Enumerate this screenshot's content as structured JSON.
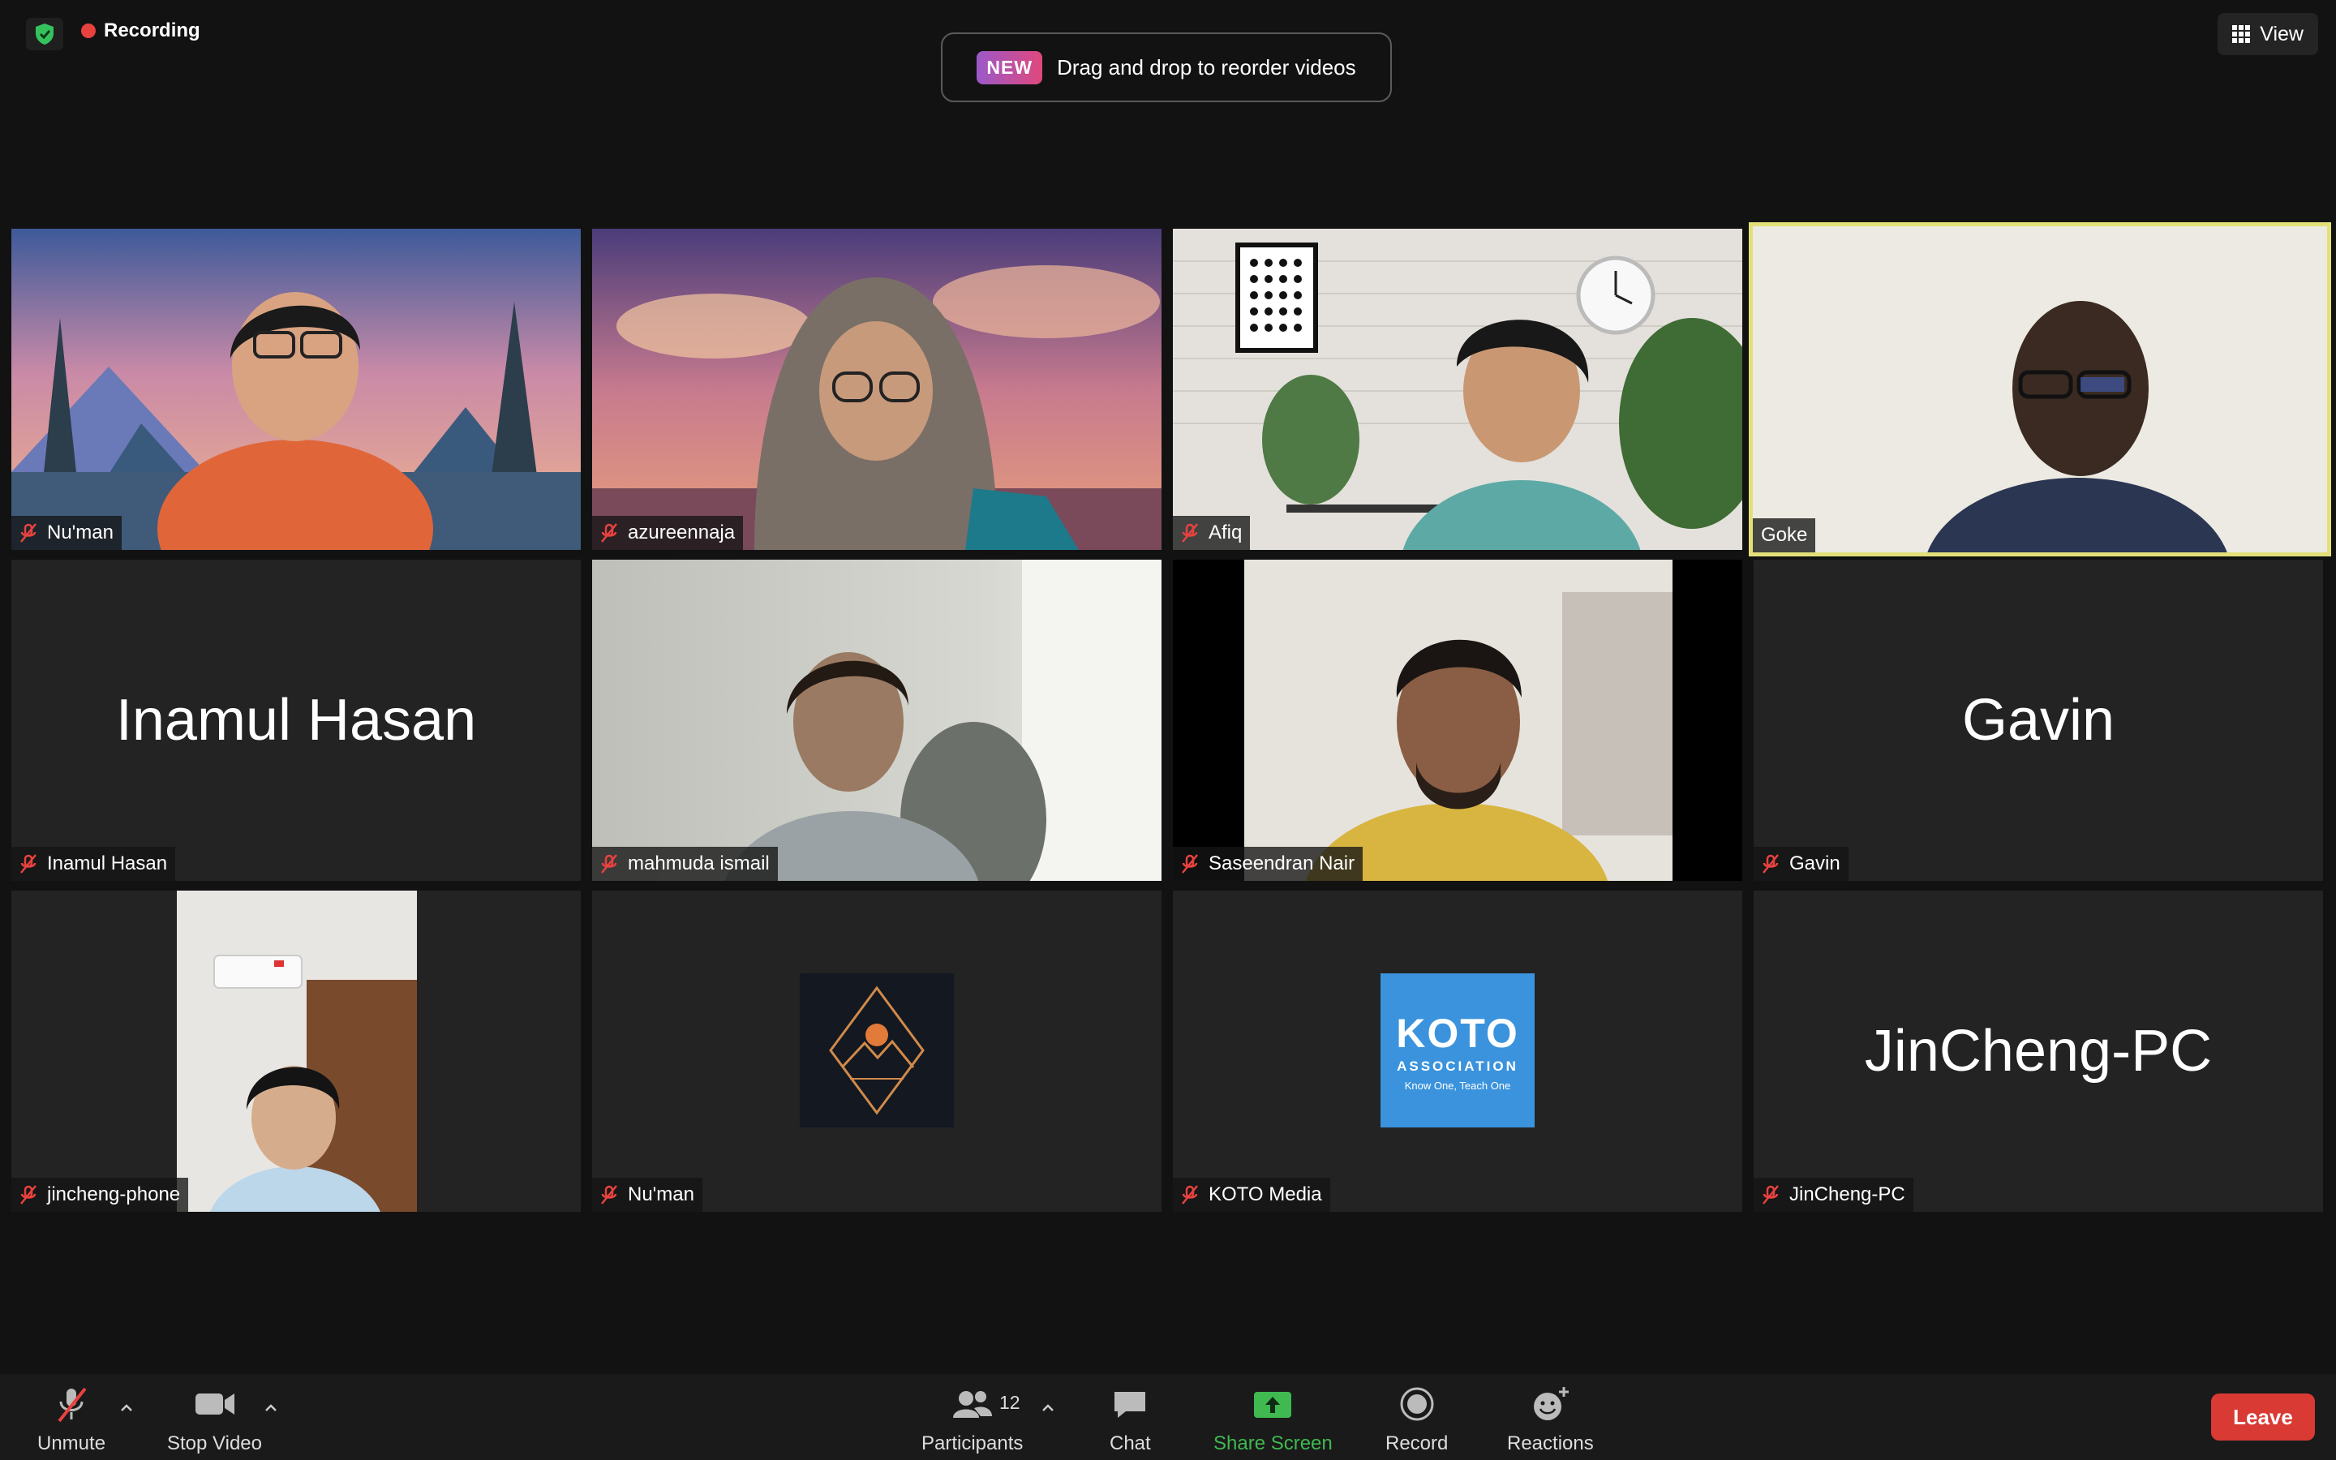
{
  "meeting": {
    "recording_label": "Recording",
    "banner_badge": "NEW",
    "banner_text": "Drag and drop to reorder videos",
    "view_label": "View"
  },
  "participants": [
    {
      "name": "Nu'man",
      "video": "photo",
      "muted": true
    },
    {
      "name": "azureennaja",
      "video": "photo",
      "muted": true
    },
    {
      "name": "Afiq",
      "video": "photo",
      "muted": true
    },
    {
      "name": "Goke",
      "video": "photo",
      "muted": false,
      "active_speaker": true
    },
    {
      "name": "Inamul Hasan",
      "video": "off",
      "muted": true,
      "display_text": "Inamul Hasan"
    },
    {
      "name": "mahmuda ismail",
      "video": "photo",
      "muted": true
    },
    {
      "name": "Saseendran Nair",
      "video": "photo",
      "muted": true
    },
    {
      "name": "Gavin",
      "video": "off",
      "muted": true,
      "display_text": "Gavin"
    },
    {
      "name": "jincheng-phone",
      "video": "photo",
      "muted": true
    },
    {
      "name": "Nu'man",
      "video": "avatar",
      "muted": true
    },
    {
      "name": "KOTO Media",
      "video": "avatar",
      "muted": true,
      "logo_text": "KOTO",
      "logo_subtitle": "ASSOCIATION",
      "logo_tagline": "Know One, Teach One"
    },
    {
      "name": "JinCheng-PC",
      "video": "off",
      "muted": true,
      "display_text": "JinCheng-PC"
    }
  ],
  "toolbar": {
    "unmute": "Unmute",
    "stop_video": "Stop Video",
    "participants": "Participants",
    "participant_count": "12",
    "chat": "Chat",
    "share_screen": "Share Screen",
    "record": "Record",
    "reactions": "Reactions",
    "leave": "Leave"
  },
  "colors": {
    "background": "#121212",
    "tile": "#232323",
    "active_border": "#e3e07a",
    "share_green": "#3fb950",
    "leave_red": "#d93a34",
    "recording_red": "#e8423f",
    "koto_blue": "#3a93dc"
  }
}
